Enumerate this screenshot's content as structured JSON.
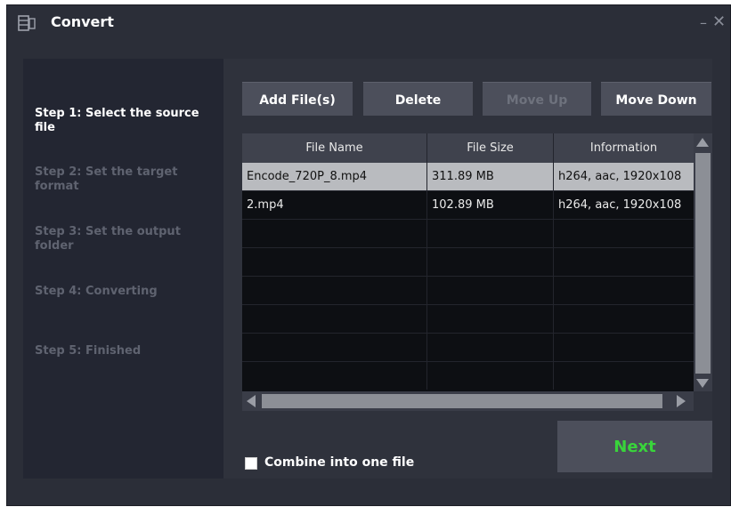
{
  "window": {
    "title": "Convert",
    "minimize_label": "–",
    "close_label": "✕"
  },
  "steps": [
    {
      "label": "Step 1: Select the source file",
      "active": true
    },
    {
      "label": "Step 2: Set the target format",
      "active": false
    },
    {
      "label": "Step 3: Set the output folder",
      "active": false
    },
    {
      "label": "Step 4: Converting",
      "active": false
    },
    {
      "label": "Step 5: Finished",
      "active": false
    }
  ],
  "toolbar": {
    "add_label": "Add File(s)",
    "delete_label": "Delete",
    "move_up_label": "Move Up",
    "move_down_label": "Move Down"
  },
  "table": {
    "columns": [
      "File Name",
      "File Size",
      "Information"
    ],
    "rows": [
      {
        "name": "Encode_720P_8.mp4",
        "size": "311.89 MB",
        "info": "h264, aac, 1920x108",
        "selected": true
      },
      {
        "name": "2.mp4",
        "size": "102.89 MB",
        "info": "h264, aac, 1920x108",
        "selected": false
      }
    ]
  },
  "options": {
    "combine_label": "Combine into one file",
    "combine_checked": false
  },
  "footer": {
    "next_label": "Next"
  },
  "colors": {
    "window_bg": "#2b2e38",
    "sidebar_bg": "#232632",
    "button_bg": "#4c4f5b",
    "next_text": "#39d43b",
    "selected_row": "#b9bbbf"
  }
}
